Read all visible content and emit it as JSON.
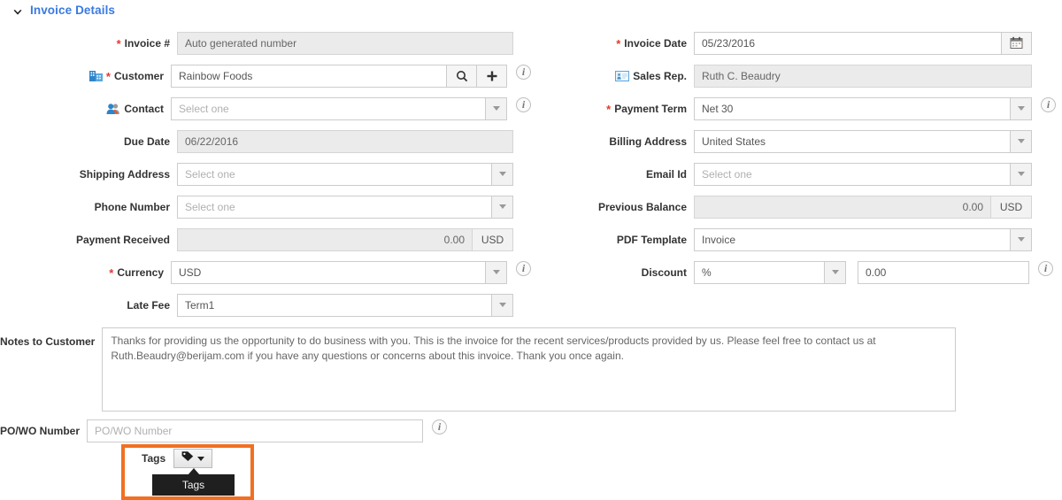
{
  "section": {
    "title": "Invoice Details",
    "collapse_icon": "chevron-down-icon",
    "accent_color": "#3a7ae0"
  },
  "left_column": {
    "invoice_number": {
      "label": "Invoice #",
      "required": true,
      "placeholder": "Auto generated number",
      "value": "Auto generated number",
      "disabled": true
    },
    "customer": {
      "label": "Customer",
      "required": true,
      "icon": "building-icon",
      "value": "Rainbow Foods",
      "search_icon": "search-icon",
      "add_icon": "plus-icon",
      "info_icon": "info-icon"
    },
    "contact": {
      "label": "Contact",
      "icon": "contact-people-icon",
      "placeholder": "Select one",
      "value": "Select one",
      "info_icon": "info-icon"
    },
    "due_date": {
      "label": "Due Date",
      "value": "06/22/2016",
      "disabled": true
    },
    "shipping_address": {
      "label": "Shipping Address",
      "placeholder": "Select one",
      "value": "Select one"
    },
    "phone_number": {
      "label": "Phone Number",
      "placeholder": "Select one",
      "value": "Select one"
    },
    "payment_received": {
      "label": "Payment Received",
      "value": "0.00",
      "unit": "USD",
      "disabled": true
    },
    "currency": {
      "label": "Currency",
      "required": true,
      "value": "USD",
      "info_icon": "info-icon"
    },
    "late_fee": {
      "label": "Late Fee",
      "value": "Term1"
    }
  },
  "right_column": {
    "invoice_date": {
      "label": "Invoice Date",
      "required": true,
      "value": "05/23/2016",
      "calendar_icon": "calendar-icon"
    },
    "sales_rep": {
      "label": "Sales Rep.",
      "icon": "id-badge-icon",
      "value": "Ruth C. Beaudry",
      "disabled": true
    },
    "payment_term": {
      "label": "Payment Term",
      "required": true,
      "value": "Net 30",
      "info_icon": "info-icon"
    },
    "billing_address": {
      "label": "Billing Address",
      "value": "United States"
    },
    "email_id": {
      "label": "Email Id",
      "placeholder": "Select one",
      "value": "Select one"
    },
    "previous_balance": {
      "label": "Previous Balance",
      "value": "0.00",
      "unit": "USD",
      "disabled": true
    },
    "pdf_template": {
      "label": "PDF Template",
      "value": "Invoice"
    },
    "discount": {
      "label": "Discount",
      "type_value": "%",
      "amount_value": "0.00",
      "info_icon": "info-icon"
    }
  },
  "notes": {
    "label": "Notes to Customer",
    "value": "Thanks for providing us the opportunity to do business with you. This is the invoice for the recent services/products provided by us. Please feel free to contact us at Ruth.Beaudry@berijam.com if you have any questions or concerns about this invoice. Thank you once again."
  },
  "po_wo": {
    "label": "PO/WO Number",
    "placeholder": "PO/WO Number",
    "value": "PO/WO Number",
    "info_icon": "info-icon"
  },
  "tags": {
    "label": "Tags",
    "button_icon": "tag-icon",
    "caret_icon": "caret-down-icon",
    "tooltip": "Tags",
    "highlight_color": "#f26f21"
  }
}
